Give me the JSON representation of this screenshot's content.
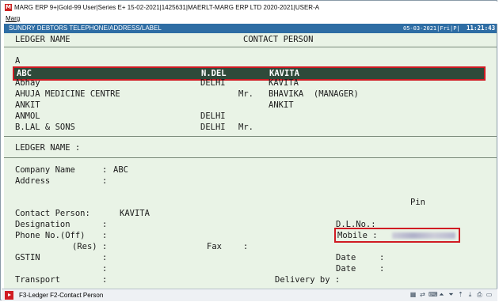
{
  "window": {
    "title": "MARG ERP 9+|Gold-99 User|Series E+ 15-02-2021|1425631|MAERLT-MARG ERP LTD 2020-2021|USER-A"
  },
  "menu": {
    "items": [
      "Marg"
    ]
  },
  "header": {
    "title": "SUNDRY DEBTORS TELEPHONE/ADDRESS/LABEL",
    "date": "05-03-2021|Fri|P|",
    "time": "11:21:43"
  },
  "list": {
    "col_ledger": "LEDGER NAME",
    "col_contact": "CONTACT PERSON",
    "group_letter": "A",
    "rows": [
      {
        "name": "ABC",
        "place": "N.DEL",
        "title": "",
        "contact": "KAVITA"
      },
      {
        "name": "Abhay",
        "place": "DELHI",
        "title": "",
        "contact": "KAVITA"
      },
      {
        "name": "AHUJA MEDICINE CENTRE",
        "place": "",
        "title": "Mr.",
        "contact": "BHAVIKA  (MANAGER)"
      },
      {
        "name": "ANKIT",
        "place": "",
        "title": "",
        "contact": "ANKIT"
      },
      {
        "name": "ANMOL",
        "place": "DELHI",
        "title": "",
        "contact": ""
      },
      {
        "name": "B.LAL & SONS",
        "place": "DELHI",
        "title": "Mr.",
        "contact": ""
      }
    ]
  },
  "search": {
    "label": "LEDGER NAME :"
  },
  "details": {
    "company_label": "Company Name",
    "company_value": "ABC",
    "address_label": "Address",
    "pin_label": "Pin",
    "contact_label": "Contact Person:",
    "contact_value": "KAVITA",
    "designation_label": "Designation",
    "dlno_label": "D.L.No.:",
    "phone_off_label": "Phone No.(Off)",
    "phone_res_label": "(Res)",
    "fax_label": "Fax",
    "mobile_label": "Mobile :",
    "gstin_label": "GSTIN",
    "date_label": "Date",
    "transport_label": "Transport",
    "delivery_label": "Delivery by :",
    "colon": ":"
  },
  "status": {
    "text": "F3-Ledger F2-Contact Person"
  },
  "colors": {
    "header_bg": "#2e6da4",
    "panel_bg": "#e9f3e6",
    "highlight_border": "#d01b23",
    "selected_row_bg": "#2f4a3a"
  }
}
